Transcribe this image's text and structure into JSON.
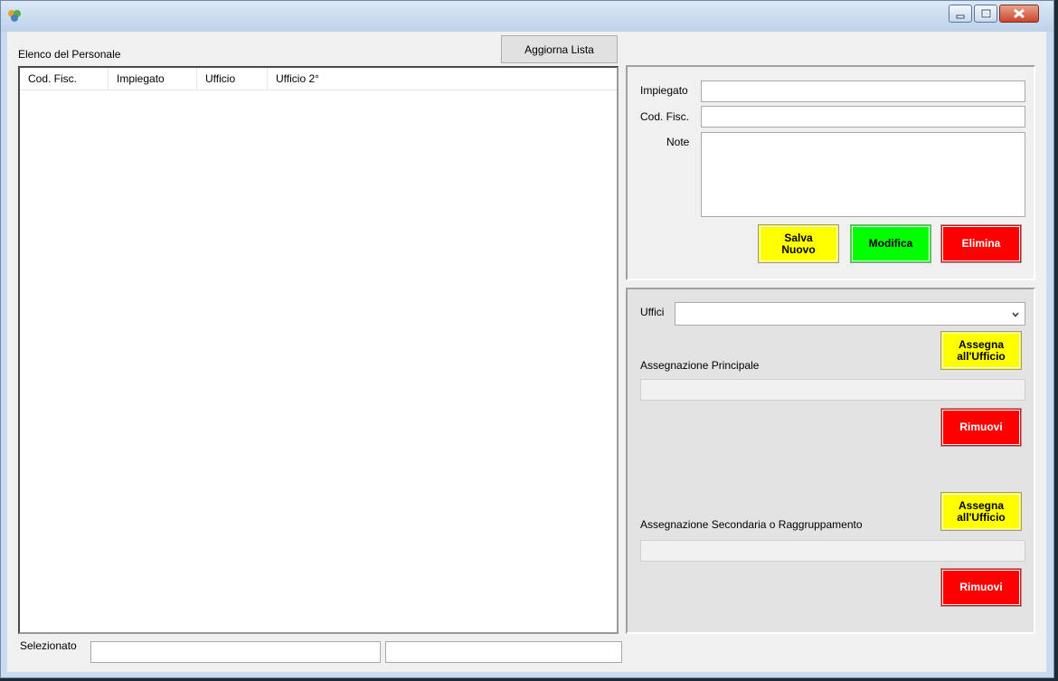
{
  "window": {
    "title": "",
    "icon": "app-icon"
  },
  "left": {
    "list_label": "Elenco del Personale",
    "refresh_button": "Aggiorna Lista",
    "columns": [
      "Cod. Fisc.",
      "Impiegato",
      "Ufficio",
      "Ufficio 2°"
    ],
    "rows": [],
    "selected_label": "Selezionato",
    "selected_value_1": "",
    "selected_value_2": ""
  },
  "employee": {
    "name_label": "Impiegato",
    "name_value": "",
    "cf_label": "Cod. Fisc.",
    "cf_value": "",
    "note_label": "Note",
    "note_value": "",
    "save_button": "Salva\nNuovo",
    "edit_button": "Modifica",
    "delete_button": "Elimina"
  },
  "offices": {
    "label": "Uffici",
    "selected": "",
    "primary_label": "Assegnazione Principale",
    "primary_value": "",
    "assign_button": "Assegna all'Ufficio",
    "remove_button": "Rimuovi",
    "secondary_label": "Assegnazione Secondaria o Raggruppamento",
    "secondary_value": ""
  },
  "colors": {
    "save": "#ffff00",
    "edit": "#00ff00",
    "delete": "#ff0000"
  }
}
